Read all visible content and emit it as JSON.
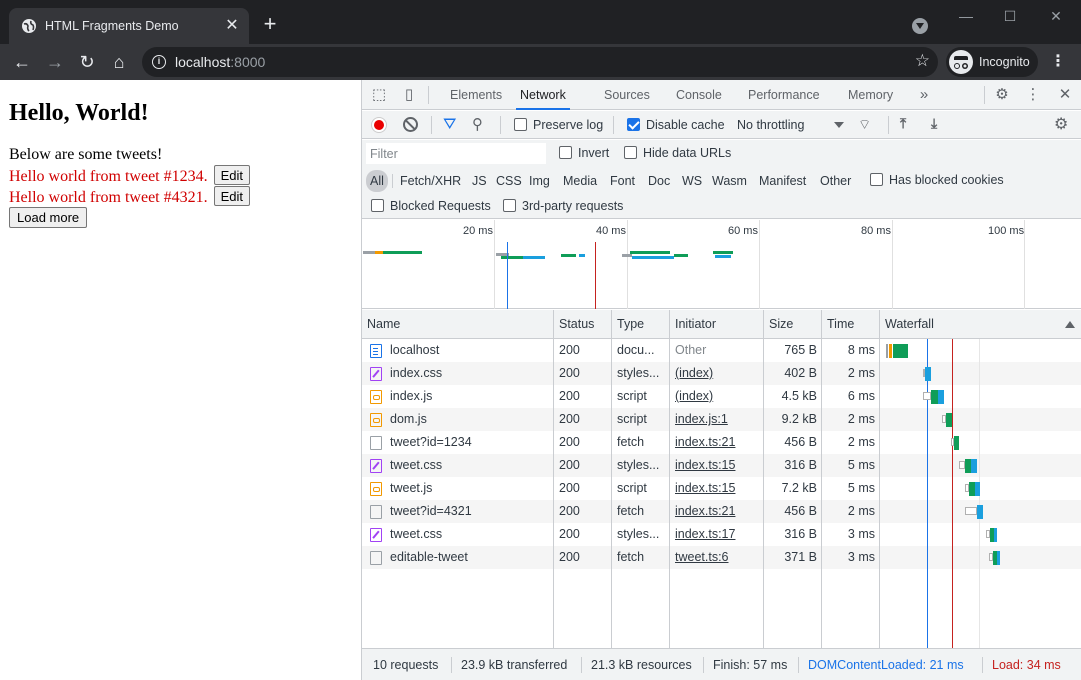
{
  "browser": {
    "tab_title": "HTML Fragments Demo",
    "url_host": "localhost",
    "url_port": ":8000",
    "incognito_label": "Incognito"
  },
  "page": {
    "heading": "Hello, World!",
    "intro": "Below are some tweets!",
    "tweets": [
      {
        "text": "Hello world from tweet #1234.",
        "button": "Edit"
      },
      {
        "text": "Hello world from tweet #4321.",
        "button": "Edit"
      }
    ],
    "load_more": "Load more"
  },
  "devtools": {
    "tabs": [
      "Elements",
      "Network",
      "Sources",
      "Console",
      "Performance",
      "Memory"
    ],
    "active_tab": "Network",
    "more_tabs_icon": "chevron-double-right-icon",
    "actions": {
      "preserve_log": "Preserve log",
      "preserve_log_checked": false,
      "disable_cache": "Disable cache",
      "disable_cache_checked": true,
      "throttling": "No throttling"
    },
    "filter": {
      "placeholder": "Filter",
      "invert": "Invert",
      "hide_data_urls": "Hide data URLs",
      "types": [
        "All",
        "Fetch/XHR",
        "JS",
        "CSS",
        "Img",
        "Media",
        "Font",
        "Doc",
        "WS",
        "Wasm",
        "Manifest",
        "Other"
      ],
      "active_type": "All",
      "has_blocked_cookies": "Has blocked cookies",
      "blocked_requests": "Blocked Requests",
      "third_party": "3rd-party requests"
    },
    "overview_ticks": [
      "20 ms",
      "40 ms",
      "60 ms",
      "80 ms",
      "100 ms"
    ],
    "columns": [
      "Name",
      "Status",
      "Type",
      "Initiator",
      "Size",
      "Time",
      "Waterfall"
    ],
    "requests": [
      {
        "name": "localhost",
        "icon": "document-icon",
        "status": "200",
        "type": "docu...",
        "initiator": "Other",
        "size": "765 B",
        "time": "8 ms"
      },
      {
        "name": "index.css",
        "icon": "stylesheet-icon",
        "status": "200",
        "type": "styles...",
        "initiator": "(index)",
        "size": "402 B",
        "time": "2 ms"
      },
      {
        "name": "index.js",
        "icon": "script-icon",
        "status": "200",
        "type": "script",
        "initiator": "(index)",
        "size": "4.5 kB",
        "time": "6 ms"
      },
      {
        "name": "dom.js",
        "icon": "script-icon",
        "status": "200",
        "type": "script",
        "initiator": "index.js:1",
        "size": "9.2 kB",
        "time": "2 ms"
      },
      {
        "name": "tweet?id=1234",
        "icon": "fetch-icon",
        "status": "200",
        "type": "fetch",
        "initiator": "index.ts:21",
        "size": "456 B",
        "time": "2 ms"
      },
      {
        "name": "tweet.css",
        "icon": "stylesheet-icon",
        "status": "200",
        "type": "styles...",
        "initiator": "index.ts:15",
        "size": "316 B",
        "time": "5 ms"
      },
      {
        "name": "tweet.js",
        "icon": "script-icon",
        "status": "200",
        "type": "script",
        "initiator": "index.ts:15",
        "size": "7.2 kB",
        "time": "5 ms"
      },
      {
        "name": "tweet?id=4321",
        "icon": "fetch-icon",
        "status": "200",
        "type": "fetch",
        "initiator": "index.ts:21",
        "size": "456 B",
        "time": "2 ms"
      },
      {
        "name": "tweet.css",
        "icon": "stylesheet-icon",
        "status": "200",
        "type": "styles...",
        "initiator": "index.ts:17",
        "size": "316 B",
        "time": "3 ms"
      },
      {
        "name": "editable-tweet",
        "icon": "fetch-icon",
        "status": "200",
        "type": "fetch",
        "initiator": "tweet.ts:6",
        "size": "371 B",
        "time": "3 ms"
      }
    ],
    "status_bar": {
      "requests": "10 requests",
      "transferred": "23.9 kB transferred",
      "resources": "21.3 kB resources",
      "finish": "Finish: 57 ms",
      "dom_content_loaded": "DOMContentLoaded: 21 ms",
      "load": "Load: 34 ms"
    },
    "colors": {
      "dom_content_loaded": "#1a73e8",
      "load": "#c5221f",
      "waiting": "#0f9d58",
      "download": "#1a9fde"
    }
  }
}
